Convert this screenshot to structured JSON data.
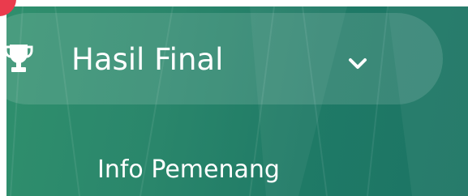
{
  "menu": {
    "title": "Hasil Final",
    "icon": "trophy-icon",
    "expand_icon": "chevron-down-icon",
    "items": [
      {
        "label": "Info Pemenang"
      }
    ]
  },
  "colors": {
    "panel_start": "#2f8f6d",
    "panel_end": "#1c7464",
    "highlight": "rgba(255,255,255,0.13)",
    "text": "#ffffff",
    "badge": "#ea3b4d"
  }
}
